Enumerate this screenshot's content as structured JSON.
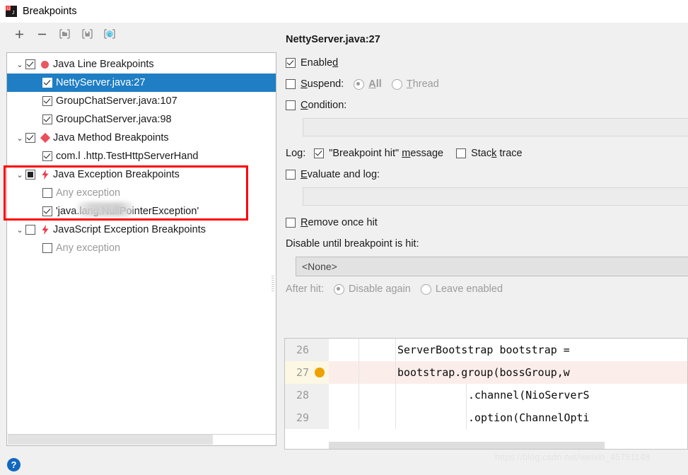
{
  "window": {
    "title": "Breakpoints",
    "icon": "intellij-idea-icon"
  },
  "toolbar": {
    "buttons": [
      {
        "name": "add-breakpoint-button",
        "glyph": "+"
      },
      {
        "name": "remove-breakpoint-button",
        "glyph": "−"
      },
      {
        "name": "open-group-icon",
        "glyph": "folder"
      },
      {
        "name": "save-group-icon",
        "glyph": "save"
      },
      {
        "name": "copy-icon",
        "glyph": "C"
      }
    ]
  },
  "tree": {
    "items": [
      {
        "label": "Java Line Breakpoints",
        "level": 0,
        "chevron": "⌄",
        "checkbox": "checked",
        "icon": "line-breakpoint-dot-icon",
        "selected": false,
        "dim": false
      },
      {
        "label": "NettyServer.java:27",
        "level": 2,
        "chevron": "",
        "checkbox": "checked",
        "icon": "",
        "selected": true,
        "dim": false
      },
      {
        "label": "GroupChatServer.java:107",
        "level": 2,
        "chevron": "",
        "checkbox": "checked",
        "icon": "",
        "selected": false,
        "dim": false
      },
      {
        "label": "GroupChatServer.java:98",
        "level": 2,
        "chevron": "",
        "checkbox": "checked",
        "icon": "",
        "selected": false,
        "dim": false
      },
      {
        "label": "Java Method Breakpoints",
        "level": 0,
        "chevron": "⌄",
        "checkbox": "checked",
        "icon": "method-breakpoint-diamond-icon",
        "selected": false,
        "dim": false
      },
      {
        "label": "com.l                 .http.TestHttpServerHand",
        "level": 2,
        "chevron": "",
        "checkbox": "checked",
        "icon": "",
        "selected": false,
        "dim": false
      },
      {
        "label": "Java Exception Breakpoints",
        "level": 0,
        "chevron": "⌄",
        "checkbox": "partial",
        "icon": "exception-breakpoint-bolt-icon",
        "selected": false,
        "dim": false
      },
      {
        "label": "Any exception",
        "level": 2,
        "chevron": "",
        "checkbox": "unchecked",
        "icon": "",
        "selected": false,
        "dim": true
      },
      {
        "label": "'java.lang.NullPointerException'",
        "level": 2,
        "chevron": "",
        "checkbox": "checked",
        "icon": "",
        "selected": false,
        "dim": false
      },
      {
        "label": "JavaScript Exception Breakpoints",
        "level": 0,
        "chevron": "⌄",
        "checkbox": "unchecked",
        "icon": "exception-breakpoint-bolt-icon",
        "selected": false,
        "dim": false
      },
      {
        "label": "Any exception",
        "level": 2,
        "chevron": "",
        "checkbox": "unchecked",
        "icon": "",
        "selected": false,
        "dim": true
      }
    ]
  },
  "detail": {
    "title": "NettyServer.java:27",
    "enabled_label": "Enabled",
    "enabled_checked": true,
    "suspend_label": "Suspend:",
    "suspend_checked": false,
    "suspend_all": "All",
    "suspend_thread": "Thread",
    "suspend_selected": "All",
    "condition_label": "Condition:",
    "condition_checked": false,
    "condition_value": "",
    "log_label": "Log:",
    "log_message_label": "\"Breakpoint hit\" message",
    "log_message_checked": true,
    "stack_trace_label": "Stack trace",
    "stack_trace_checked": false,
    "evaluate_label": "Evaluate and log:",
    "evaluate_checked": false,
    "evaluate_value": "",
    "remove_once_hit_label": "Remove once hit",
    "remove_once_hit_checked": false,
    "disable_until_label": "Disable until breakpoint is hit:",
    "disable_until_value": "<None>",
    "after_hit_label": "After hit:",
    "after_hit_disable_again": "Disable again",
    "after_hit_leave_enabled": "Leave enabled",
    "after_hit_selected": "Disable again"
  },
  "code_preview": {
    "lines": [
      {
        "number": "26",
        "text": "ServerBootstrap bootstrap =",
        "breakpoint": false,
        "highlight": false,
        "indent": 0
      },
      {
        "number": "27",
        "text": "bootstrap.group(bossGroup,w",
        "breakpoint": true,
        "highlight": true,
        "indent": 0
      },
      {
        "number": "28",
        "text": ".channel(NioServerS",
        "breakpoint": false,
        "highlight": false,
        "indent": 1
      },
      {
        "number": "29",
        "text": ".option(ChannelOpti",
        "breakpoint": false,
        "highlight": false,
        "indent": 1
      }
    ]
  },
  "help_button": {
    "label": "?"
  },
  "watermark": {
    "text": "https://blog.csdn.net/weixin_45751148"
  },
  "colors": {
    "selection": "#1f7ec4",
    "annotation": "#ff0000",
    "breakpoint_dot": "#eda200",
    "line_breakpoint": "#e8585f",
    "method_breakpoint": "#ee4d5a",
    "help": "#1068bf"
  }
}
